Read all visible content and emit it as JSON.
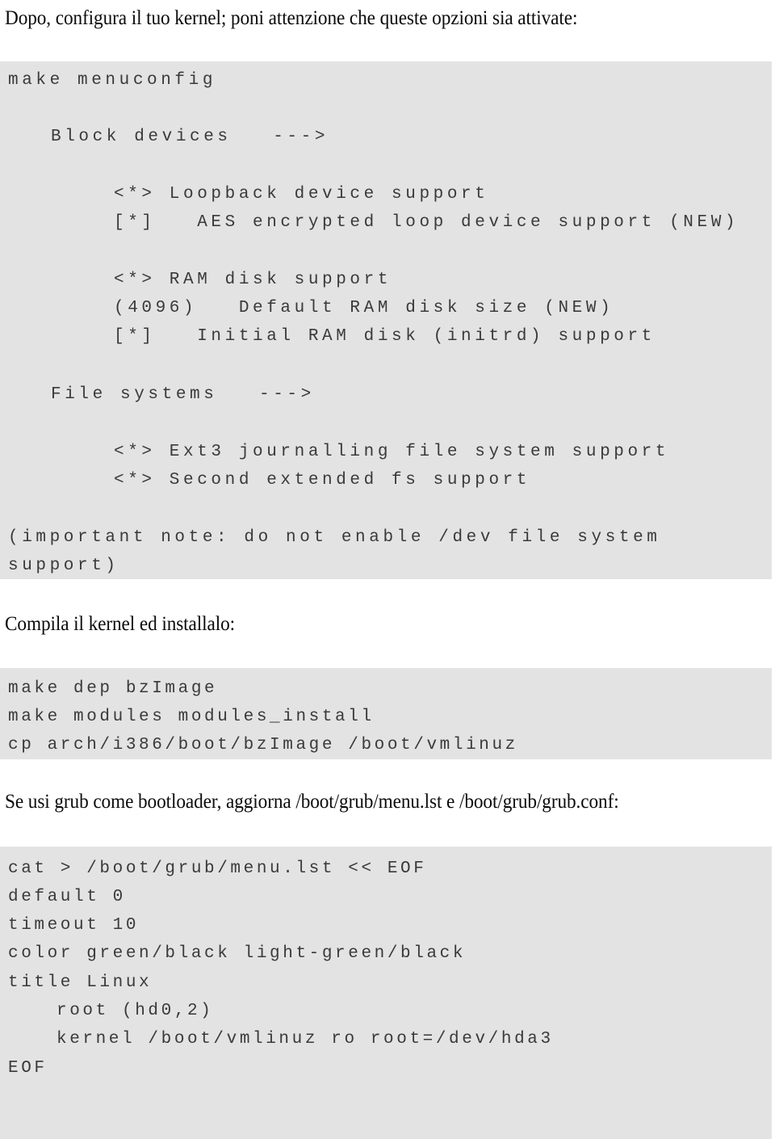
{
  "document": {
    "type": "technical-guide-page",
    "language": "it",
    "background_color": "#ffffff",
    "code_block_color": "#e3e3e3",
    "code_text_color": "#3a3a3a",
    "prose_text_color": "#0b0b0b"
  },
  "paragraphs": {
    "intro": "Dopo, configura il tuo kernel; poni attenzione che queste opzioni sia attivate:",
    "compile": "Compila il kernel ed installalo:",
    "grub": "Se usi grub come bootloader, aggiorna /boot/grub/menu.lst e /boot/grub/grub.conf:"
  },
  "code_blocks": [
    {
      "id": "menuconfig-block",
      "lines": [
        "make menuconfig",
        "",
        "Block devices   --->",
        "",
        "<*> Loopback device support",
        "[*]   AES encrypted loop device support (NEW)",
        "",
        "<*> RAM disk support",
        "(4096)   Default RAM disk size (NEW)",
        "[*]   Initial RAM disk (initrd) support",
        "",
        "File systems   --->",
        "",
        "<*> Ext3 journalling file system support",
        "<*> Second extended fs support",
        "",
        "(important note: do not enable /dev file system",
        "support)"
      ]
    },
    {
      "id": "compile-block",
      "lines": [
        "make dep bzImage",
        "make modules modules_install",
        "cp arch/i386/boot/bzImage /boot/vmlinuz"
      ]
    },
    {
      "id": "grub-block",
      "lines": [
        "cat > /boot/grub/menu.lst << EOF",
        "default 0",
        "timeout 10",
        "color green/black light-green/black",
        "title Linux",
        "    root (hd0,2)",
        "    kernel /boot/vmlinuz ro root=/dev/hda3",
        "EOF"
      ]
    }
  ],
  "code_line_text": {
    "b1_l0": "make menuconfig",
    "b1_l1": "Block devices   --->",
    "b1_l2": "<*> Loopback device support",
    "b1_l3": "[*]   AES encrypted loop device support (NEW)",
    "b1_l4": "<*> RAM disk support",
    "b1_l5": "(4096)   Default RAM disk size (NEW)",
    "b1_l6": "[*]   Initial RAM disk (initrd) support",
    "b1_l7": "File systems   --->",
    "b1_l8": "<*> Ext3 journalling file system support",
    "b1_l9": "<*> Second extended fs support",
    "b1_l10": "(important note: do not enable /dev file system",
    "b1_l11": "support)",
    "b2_l0": "make dep bzImage",
    "b2_l1": "make modules modules_install",
    "b2_l2": "cp arch/i386/boot/bzImage /boot/vmlinuz",
    "b3_l0": "cat > /boot/grub/menu.lst << EOF",
    "b3_l1": "default 0",
    "b3_l2": "timeout 10",
    "b3_l3": "color green/black light-green/black",
    "b3_l4": "title Linux",
    "b3_l5": "root (hd0,2)",
    "b3_l6": "kernel /boot/vmlinuz ro root=/dev/hda3",
    "b3_l7": "EOF"
  }
}
